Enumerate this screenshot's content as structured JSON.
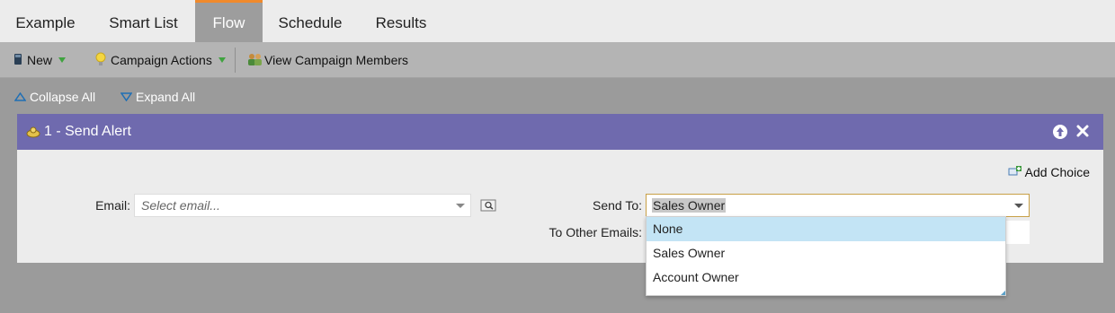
{
  "tabs": [
    {
      "label": "Example"
    },
    {
      "label": "Smart List"
    },
    {
      "label": "Flow",
      "active": true
    },
    {
      "label": "Schedule"
    },
    {
      "label": "Results"
    }
  ],
  "toolbar": {
    "new_label": "New",
    "campaign_actions_label": "Campaign Actions",
    "view_members_label": "View Campaign Members"
  },
  "outline": {
    "collapse_label": "Collapse All",
    "expand_label": "Expand All"
  },
  "step": {
    "title": "1 - Send Alert",
    "add_choice_label": "Add Choice",
    "email_label": "Email:",
    "email_placeholder": "Select email...",
    "send_to_label": "Send To:",
    "send_to_value": "Sales Owner",
    "other_emails_label": "To Other Emails:"
  },
  "dropdown": {
    "options": [
      "None",
      "Sales Owner",
      "Account Owner"
    ],
    "highlighted_index": 0
  },
  "colors": {
    "active_tab_accent": "#f08a2c",
    "step_header": "#6f6aae",
    "highlight": "#c3e4f5"
  }
}
